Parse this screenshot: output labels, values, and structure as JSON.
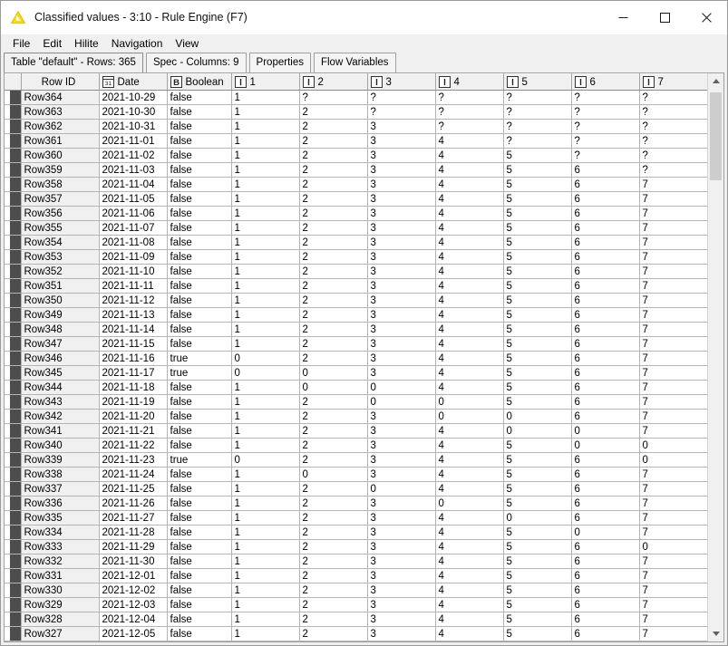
{
  "window": {
    "title": "Classified values - 3:10 - Rule Engine (F7)",
    "icon": "knime-node-icon",
    "minimize_label": "–",
    "maximize_label": "□",
    "close_label": "✕"
  },
  "menubar": {
    "items": [
      {
        "label": "File",
        "name": "menu-file"
      },
      {
        "label": "Edit",
        "name": "menu-edit"
      },
      {
        "label": "Hilite",
        "name": "menu-hilite"
      },
      {
        "label": "Navigation",
        "name": "menu-navigation"
      },
      {
        "label": "View",
        "name": "menu-view"
      }
    ]
  },
  "tabs": [
    {
      "label": "Table \"default\" - Rows: 365",
      "active": true
    },
    {
      "label": "Spec - Columns: 9",
      "active": false
    },
    {
      "label": "Properties",
      "active": false
    },
    {
      "label": "Flow Variables",
      "active": false
    }
  ],
  "table": {
    "columns": [
      {
        "label": "Row ID",
        "icon": "none",
        "type": "rowid"
      },
      {
        "label": "Date",
        "icon": "calendar-icon",
        "type": "date"
      },
      {
        "label": "Boolean",
        "icon": "boolean-icon",
        "type": "boolean"
      },
      {
        "label": "1",
        "icon": "integer-icon",
        "type": "integer"
      },
      {
        "label": "2",
        "icon": "integer-icon",
        "type": "integer"
      },
      {
        "label": "3",
        "icon": "integer-icon",
        "type": "integer"
      },
      {
        "label": "4",
        "icon": "integer-icon",
        "type": "integer"
      },
      {
        "label": "5",
        "icon": "integer-icon",
        "type": "integer"
      },
      {
        "label": "6",
        "icon": "integer-icon",
        "type": "integer"
      },
      {
        "label": "7",
        "icon": "integer-icon",
        "type": "integer"
      }
    ],
    "missing_value_symbol": "?",
    "missing_value_color": "#e00000",
    "rows": [
      {
        "rowid": "Row364",
        "date": "2021-10-29",
        "boolean": "false",
        "values": [
          "1",
          "?",
          "?",
          "?",
          "?",
          "?",
          "?"
        ]
      },
      {
        "rowid": "Row363",
        "date": "2021-10-30",
        "boolean": "false",
        "values": [
          "1",
          "2",
          "?",
          "?",
          "?",
          "?",
          "?"
        ]
      },
      {
        "rowid": "Row362",
        "date": "2021-10-31",
        "boolean": "false",
        "values": [
          "1",
          "2",
          "3",
          "?",
          "?",
          "?",
          "?"
        ]
      },
      {
        "rowid": "Row361",
        "date": "2021-11-01",
        "boolean": "false",
        "values": [
          "1",
          "2",
          "3",
          "4",
          "?",
          "?",
          "?"
        ]
      },
      {
        "rowid": "Row360",
        "date": "2021-11-02",
        "boolean": "false",
        "values": [
          "1",
          "2",
          "3",
          "4",
          "5",
          "?",
          "?"
        ]
      },
      {
        "rowid": "Row359",
        "date": "2021-11-03",
        "boolean": "false",
        "values": [
          "1",
          "2",
          "3",
          "4",
          "5",
          "6",
          "?"
        ]
      },
      {
        "rowid": "Row358",
        "date": "2021-11-04",
        "boolean": "false",
        "values": [
          "1",
          "2",
          "3",
          "4",
          "5",
          "6",
          "7"
        ]
      },
      {
        "rowid": "Row357",
        "date": "2021-11-05",
        "boolean": "false",
        "values": [
          "1",
          "2",
          "3",
          "4",
          "5",
          "6",
          "7"
        ]
      },
      {
        "rowid": "Row356",
        "date": "2021-11-06",
        "boolean": "false",
        "values": [
          "1",
          "2",
          "3",
          "4",
          "5",
          "6",
          "7"
        ]
      },
      {
        "rowid": "Row355",
        "date": "2021-11-07",
        "boolean": "false",
        "values": [
          "1",
          "2",
          "3",
          "4",
          "5",
          "6",
          "7"
        ]
      },
      {
        "rowid": "Row354",
        "date": "2021-11-08",
        "boolean": "false",
        "values": [
          "1",
          "2",
          "3",
          "4",
          "5",
          "6",
          "7"
        ]
      },
      {
        "rowid": "Row353",
        "date": "2021-11-09",
        "boolean": "false",
        "values": [
          "1",
          "2",
          "3",
          "4",
          "5",
          "6",
          "7"
        ]
      },
      {
        "rowid": "Row352",
        "date": "2021-11-10",
        "boolean": "false",
        "values": [
          "1",
          "2",
          "3",
          "4",
          "5",
          "6",
          "7"
        ]
      },
      {
        "rowid": "Row351",
        "date": "2021-11-11",
        "boolean": "false",
        "values": [
          "1",
          "2",
          "3",
          "4",
          "5",
          "6",
          "7"
        ]
      },
      {
        "rowid": "Row350",
        "date": "2021-11-12",
        "boolean": "false",
        "values": [
          "1",
          "2",
          "3",
          "4",
          "5",
          "6",
          "7"
        ]
      },
      {
        "rowid": "Row349",
        "date": "2021-11-13",
        "boolean": "false",
        "values": [
          "1",
          "2",
          "3",
          "4",
          "5",
          "6",
          "7"
        ]
      },
      {
        "rowid": "Row348",
        "date": "2021-11-14",
        "boolean": "false",
        "values": [
          "1",
          "2",
          "3",
          "4",
          "5",
          "6",
          "7"
        ]
      },
      {
        "rowid": "Row347",
        "date": "2021-11-15",
        "boolean": "false",
        "values": [
          "1",
          "2",
          "3",
          "4",
          "5",
          "6",
          "7"
        ]
      },
      {
        "rowid": "Row346",
        "date": "2021-11-16",
        "boolean": "true",
        "values": [
          "0",
          "2",
          "3",
          "4",
          "5",
          "6",
          "7"
        ]
      },
      {
        "rowid": "Row345",
        "date": "2021-11-17",
        "boolean": "true",
        "values": [
          "0",
          "0",
          "3",
          "4",
          "5",
          "6",
          "7"
        ]
      },
      {
        "rowid": "Row344",
        "date": "2021-11-18",
        "boolean": "false",
        "values": [
          "1",
          "0",
          "0",
          "4",
          "5",
          "6",
          "7"
        ]
      },
      {
        "rowid": "Row343",
        "date": "2021-11-19",
        "boolean": "false",
        "values": [
          "1",
          "2",
          "0",
          "0",
          "5",
          "6",
          "7"
        ]
      },
      {
        "rowid": "Row342",
        "date": "2021-11-20",
        "boolean": "false",
        "values": [
          "1",
          "2",
          "3",
          "0",
          "0",
          "6",
          "7"
        ]
      },
      {
        "rowid": "Row341",
        "date": "2021-11-21",
        "boolean": "false",
        "values": [
          "1",
          "2",
          "3",
          "4",
          "0",
          "0",
          "7"
        ]
      },
      {
        "rowid": "Row340",
        "date": "2021-11-22",
        "boolean": "false",
        "values": [
          "1",
          "2",
          "3",
          "4",
          "5",
          "0",
          "0"
        ]
      },
      {
        "rowid": "Row339",
        "date": "2021-11-23",
        "boolean": "true",
        "values": [
          "0",
          "2",
          "3",
          "4",
          "5",
          "6",
          "0"
        ]
      },
      {
        "rowid": "Row338",
        "date": "2021-11-24",
        "boolean": "false",
        "values": [
          "1",
          "0",
          "3",
          "4",
          "5",
          "6",
          "7"
        ]
      },
      {
        "rowid": "Row337",
        "date": "2021-11-25",
        "boolean": "false",
        "values": [
          "1",
          "2",
          "0",
          "4",
          "5",
          "6",
          "7"
        ]
      },
      {
        "rowid": "Row336",
        "date": "2021-11-26",
        "boolean": "false",
        "values": [
          "1",
          "2",
          "3",
          "0",
          "5",
          "6",
          "7"
        ]
      },
      {
        "rowid": "Row335",
        "date": "2021-11-27",
        "boolean": "false",
        "values": [
          "1",
          "2",
          "3",
          "4",
          "0",
          "6",
          "7"
        ]
      },
      {
        "rowid": "Row334",
        "date": "2021-11-28",
        "boolean": "false",
        "values": [
          "1",
          "2",
          "3",
          "4",
          "5",
          "0",
          "7"
        ]
      },
      {
        "rowid": "Row333",
        "date": "2021-11-29",
        "boolean": "false",
        "values": [
          "1",
          "2",
          "3",
          "4",
          "5",
          "6",
          "0"
        ]
      },
      {
        "rowid": "Row332",
        "date": "2021-11-30",
        "boolean": "false",
        "values": [
          "1",
          "2",
          "3",
          "4",
          "5",
          "6",
          "7"
        ]
      },
      {
        "rowid": "Row331",
        "date": "2021-12-01",
        "boolean": "false",
        "values": [
          "1",
          "2",
          "3",
          "4",
          "5",
          "6",
          "7"
        ]
      },
      {
        "rowid": "Row330",
        "date": "2021-12-02",
        "boolean": "false",
        "values": [
          "1",
          "2",
          "3",
          "4",
          "5",
          "6",
          "7"
        ]
      },
      {
        "rowid": "Row329",
        "date": "2021-12-03",
        "boolean": "false",
        "values": [
          "1",
          "2",
          "3",
          "4",
          "5",
          "6",
          "7"
        ]
      },
      {
        "rowid": "Row328",
        "date": "2021-12-04",
        "boolean": "false",
        "values": [
          "1",
          "2",
          "3",
          "4",
          "5",
          "6",
          "7"
        ]
      },
      {
        "rowid": "Row327",
        "date": "2021-12-05",
        "boolean": "false",
        "values": [
          "1",
          "2",
          "3",
          "4",
          "5",
          "6",
          "7"
        ]
      }
    ]
  },
  "scrollbar": {
    "up_arrow": "scroll-up-icon",
    "down_arrow": "scroll-down-icon"
  },
  "colors": {
    "accent_yellow": "#ffd800",
    "missing_red": "#e00000",
    "header_bg": "#f0f0f0",
    "grid_line": "#b4b4b4"
  }
}
